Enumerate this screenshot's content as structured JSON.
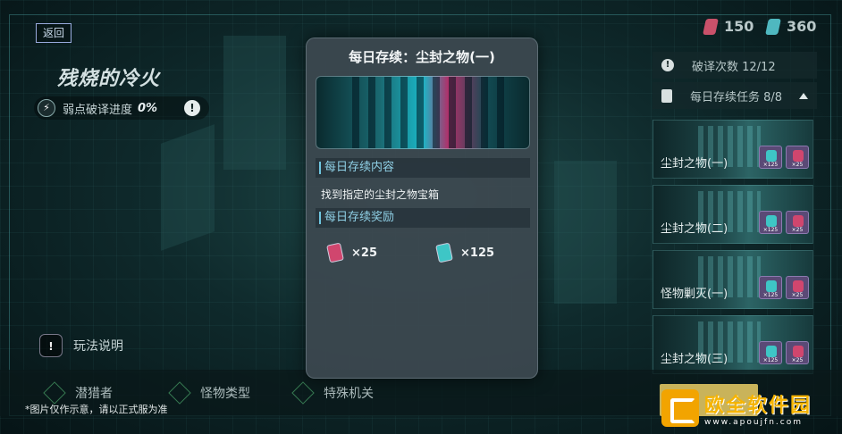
{
  "header": {
    "back_label": "返回",
    "stage_title": "残烧的冷火",
    "weakness_progress_label": "弱点破译进度",
    "weakness_progress_value": "0%"
  },
  "currency": [
    {
      "icon": "red-gem-icon",
      "value": "150",
      "color": "#c9516a"
    },
    {
      "icon": "cyan-gem-icon",
      "value": "360",
      "color": "#4fb8c0"
    }
  ],
  "right_panel": {
    "decode_count_label": "破译次数 12/12",
    "daily_tasks_label": "每日存续任务 8/8",
    "tasks": [
      {
        "label": "尘封之物(一)",
        "chip1": "×125",
        "chip2": "×25"
      },
      {
        "label": "尘封之物(二)",
        "chip1": "×125",
        "chip2": "×25"
      },
      {
        "label": "怪物剿灭(一)",
        "chip1": "×125",
        "chip2": "×25"
      },
      {
        "label": "尘封之物(三)",
        "chip1": "×125",
        "chip2": "×25"
      }
    ]
  },
  "modal": {
    "title": "每日存续：尘封之物(一)",
    "content_header": "每日存续内容",
    "content_text": "找到指定的尘封之物宝箱",
    "rewards_header": "每日存续奖励",
    "rewards": [
      {
        "icon": "red-gem-icon",
        "amount": "×25",
        "color": "#d0466e"
      },
      {
        "icon": "cyan-gem-icon",
        "amount": "×125",
        "color": "#3ec6c6"
      }
    ]
  },
  "bottom": {
    "help_label": "玩法说明",
    "tabs": [
      "潜猎者",
      "怪物类型",
      "特殊机关"
    ],
    "disclaimer": "*图片仅作示意，请以正式服为准"
  },
  "watermark": {
    "main": "欧全软件园",
    "sub": "www.apoujfn.com"
  }
}
